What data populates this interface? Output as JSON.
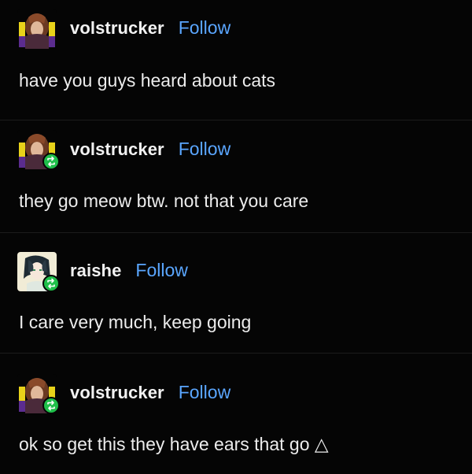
{
  "thread": {
    "posts": [
      {
        "username": "volstrucker",
        "follow_label": "Follow",
        "reblog": false,
        "avatar": "volstrucker-avatar",
        "text": "have you guys heard about cats"
      },
      {
        "username": "volstrucker",
        "follow_label": "Follow",
        "reblog": true,
        "avatar": "volstrucker-avatar",
        "text": "they go meow btw. not that you care"
      },
      {
        "username": "raishe",
        "follow_label": "Follow",
        "reblog": true,
        "avatar": "raishe-avatar",
        "text": "I care very much, keep going"
      },
      {
        "username": "volstrucker",
        "follow_label": "Follow",
        "reblog": true,
        "avatar": "volstrucker-avatar",
        "text": "ok so get this they have ears that go △"
      }
    ]
  },
  "colors": {
    "background": "#050505",
    "text": "#ececec",
    "follow_link": "#5aa6ff",
    "reblog_badge": "#1fbf4a"
  }
}
